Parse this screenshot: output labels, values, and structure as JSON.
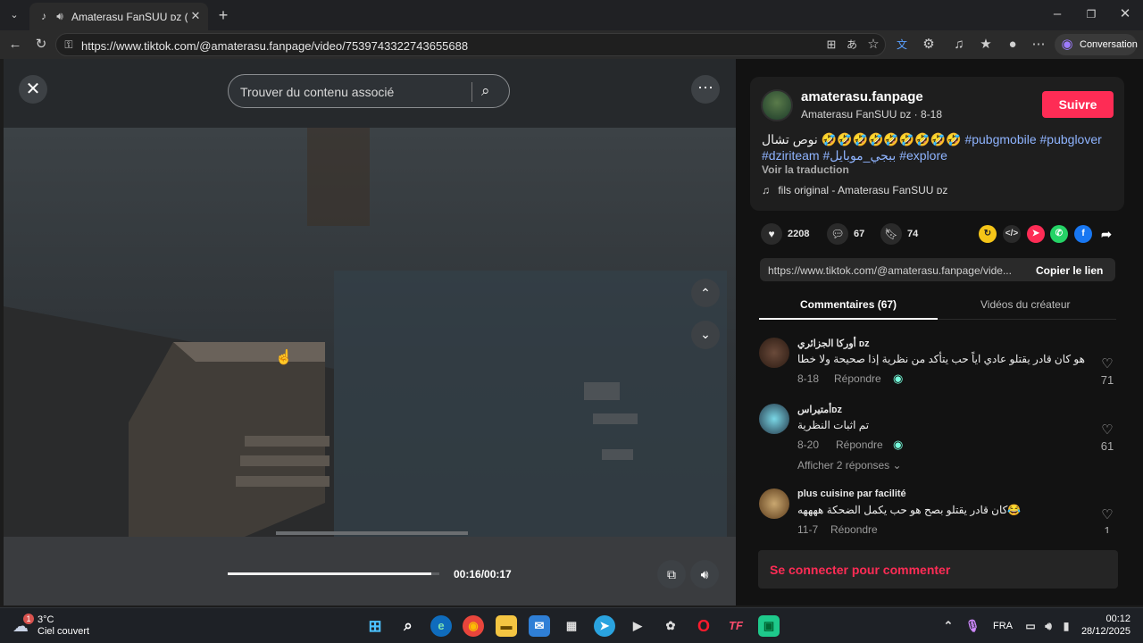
{
  "browser": {
    "tab_title": "Amaterasu FanSUU ᴅᴢ (@ama",
    "url": "https://www.tiktok.com/@amaterasu.fanpage/video/7539743322743655688",
    "conversation_label": "Conversation"
  },
  "video": {
    "search_placeholder": "Trouver du contenu associé",
    "timecode": "00:16/00:17",
    "progress_fraction": 0.96
  },
  "post": {
    "username": "amaterasu.fanpage",
    "display_name": "Amaterasu FanSUU ᴅᴢ",
    "date": "8-18",
    "follow_label": "Suivre",
    "caption_arabic": "نوص تشال 🤣🤣🤣🤣🤣🤣🤣🤣🤣",
    "hashtags": [
      "#pubgmobile",
      "#pubglover",
      "#dziriteam",
      "#ببجي_موبايل",
      "#explore"
    ],
    "translate_label": "Voir la traduction",
    "music": "fils original - Amaterasu FanSUU ᴅᴢ",
    "likes": "2208",
    "comments": "67",
    "saves": "74",
    "share_link": "https://www.tiktok.com/@amaterasu.fanpage/vide...",
    "copy_link_label": "Copier le lien"
  },
  "tabs": {
    "comments_label": "Commentaires (67)",
    "creator_videos_label": "Vidéos du créateur"
  },
  "comments": [
    {
      "author": "أوركا الجزائري ᴅᴢ",
      "text": "هو كان قادر يقتلو عادي اياً حب يتأكد من نظرية إذا صحيحة ولا خطا",
      "date": "8-18",
      "reply": "Répondre",
      "likes": "71"
    },
    {
      "author": "أمتيراسᴅᴢ",
      "text": "تم اثبات النظرية",
      "date": "8-20",
      "reply": "Répondre",
      "likes": "61",
      "show_replies": "Afficher 2 réponses"
    },
    {
      "author": "plus cuisine par facilité",
      "text": "كان قادر يقتلو بصح هو حب يكمل الضحكة ههههه😂",
      "date": "11-7",
      "reply": "Répondre",
      "likes": "1"
    }
  ],
  "login_prompt": "Se connecter pour commenter",
  "taskbar": {
    "weather_temp": "3°C",
    "weather_condition": "Ciel couvert",
    "weather_badge": "1",
    "language": "FRA",
    "time": "00:12",
    "date": "28/12/2025"
  },
  "colors": {
    "accent_red": "#fe2c55",
    "hashtag_blue": "#8fb4ff"
  }
}
